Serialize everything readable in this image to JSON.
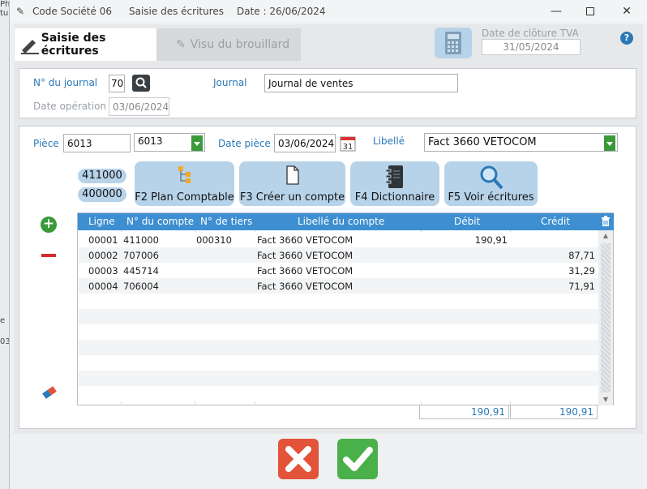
{
  "titlebar": {
    "company": "Code Société 06",
    "module": "Saisie des écritures",
    "date": "Date : 26/06/2024"
  },
  "tabs": [
    {
      "label": "Saisie des écritures"
    },
    {
      "label": "Visu du brouillard"
    }
  ],
  "tva": {
    "label": "Date de clôture TVA",
    "value": "31/05/2024"
  },
  "journal": {
    "num_label": "N° du journal",
    "num_value": "70",
    "name_label": "Journal",
    "name_value": "Journal de ventes",
    "dateop_label": "Date opération",
    "dateop_value": "03/06/2024"
  },
  "piece": {
    "label": "Pièce",
    "value": "6013",
    "select_value": "6013",
    "date_label": "Date pièce",
    "date_value": "03/06/2024",
    "libelle_label": "Libellé",
    "libelle_value": "Fact 3660 VETOCOM"
  },
  "accounts": [
    "411000",
    "400000"
  ],
  "fbuttons": [
    {
      "label": "F2 Plan Comptable"
    },
    {
      "label": "F3 Créer un compte"
    },
    {
      "label": "F4 Dictionnaire"
    },
    {
      "label": "F5 Voir écritures"
    }
  ],
  "grid": {
    "columns": [
      "Ligne",
      "N° du compte",
      "N° de tiers",
      "Libellé du compte",
      "Débit",
      "Crédit"
    ],
    "rows": [
      {
        "ligne": "00001",
        "compte": "411000",
        "tiers": "000310",
        "libelle": "Fact 3660 VETOCOM",
        "debit": "190,91",
        "credit": ""
      },
      {
        "ligne": "00002",
        "compte": "707006",
        "tiers": "",
        "libelle": "Fact 3660 VETOCOM",
        "debit": "",
        "credit": "87,71"
      },
      {
        "ligne": "00003",
        "compte": "445714",
        "tiers": "",
        "libelle": "Fact 3660 VETOCOM",
        "debit": "",
        "credit": "31,29"
      },
      {
        "ligne": "00004",
        "compte": "706004",
        "tiers": "",
        "libelle": "Fact 3660 VETOCOM",
        "debit": "",
        "credit": "71,91"
      }
    ],
    "total_debit": "190,91",
    "total_credit": "190,91"
  },
  "left_edge": [
    "tu",
    "e",
    "03"
  ],
  "colors": {
    "accent": "#3d8fd1",
    "button_bg": "#b7d3ea",
    "ok": "#49b04a",
    "cancel": "#e2533a"
  }
}
